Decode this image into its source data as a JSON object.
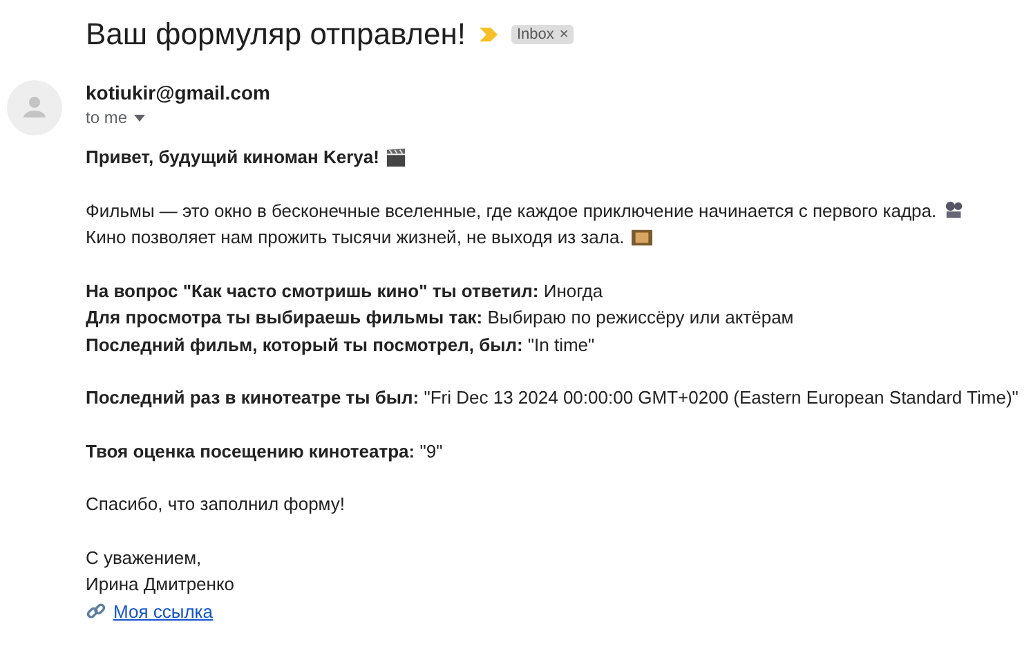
{
  "subject": "Ваш формуляр отправлен!",
  "label": {
    "text": "Inbox",
    "close": "×"
  },
  "sender": {
    "email": "kotiukir@gmail.com",
    "to": "to me"
  },
  "paragraphs": [
    {
      "lines": [
        {
          "kind": "greeting",
          "text": "Привет, будущий киноман Kerya!"
        }
      ]
    },
    {
      "lines": [
        {
          "kind": "plain",
          "text": "Фильмы — это окно в бесконечные вселенные, где каждое приключение начинается с первого кадра."
        },
        {
          "kind": "plain",
          "text": "Кино позволяет нам прожить тысячи жизней, не выходя из зала."
        }
      ]
    },
    {
      "lines": [
        {
          "kind": "answer",
          "text": "**На вопрос \"Как часто смотришь кино\" ты ответил:** Иногда"
        },
        {
          "kind": "answer",
          "text": "**Для просмотра ты выбираешь фильмы так:** Выбираю по режиссёру или актёрам"
        },
        {
          "kind": "answer",
          "text": "**Последний фильм, который ты посмотрел, был:** \"In time\""
        }
      ]
    },
    {
      "lines": [
        {
          "kind": "answer",
          "text": "**Последний раз в кинотеатре ты был:** \"Fri Dec 13 2024 00:00:00 GMT+0200 (Eastern European Standard Time)\""
        }
      ]
    },
    {
      "lines": [
        {
          "kind": "answer",
          "text": "**Твоя оценка посещению кинотеатра:** \"9\""
        }
      ]
    },
    {
      "lines": [
        {
          "kind": "plain",
          "text": "Спасибо, что заполнил форму!"
        }
      ]
    },
    {
      "lines": [
        {
          "kind": "plain",
          "text": "С уважением,"
        },
        {
          "kind": "plain",
          "text": "Ирина Дмитренко"
        },
        {
          "kind": "link",
          "text": "Моя ссылка"
        }
      ]
    }
  ]
}
